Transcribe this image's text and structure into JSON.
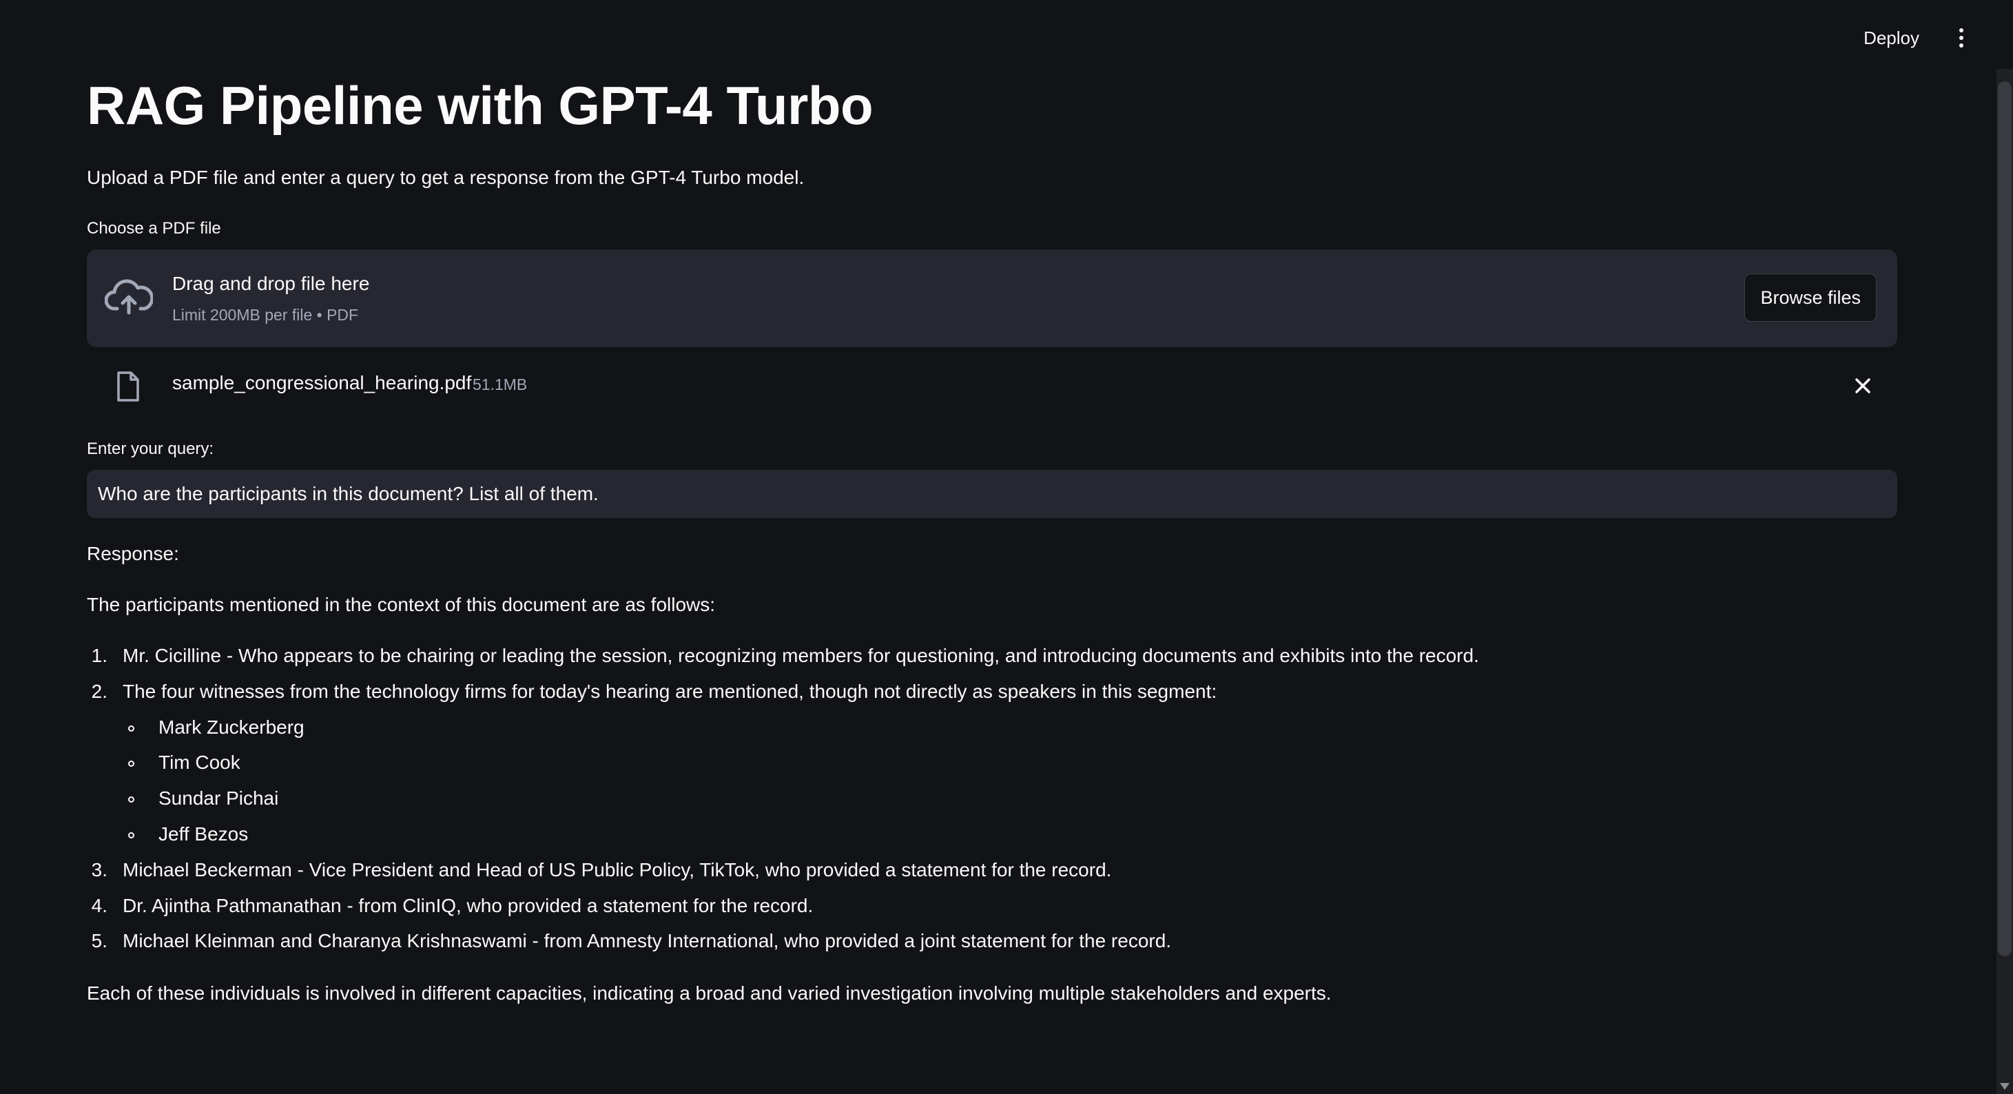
{
  "header": {
    "deploy_label": "Deploy",
    "menu_icon": "kebab-menu-icon"
  },
  "main": {
    "title": "RAG Pipeline with GPT-4 Turbo",
    "subtitle": "Upload a PDF file and enter a query to get a response from the GPT-4 Turbo model."
  },
  "uploader": {
    "label": "Choose a PDF file",
    "drop_text": "Drag and drop file here",
    "limit_text": "Limit 200MB per file • PDF",
    "browse_label": "Browse files",
    "icon": "upload-cloud-icon",
    "file": {
      "name": "sample_congressional_hearing.pdf",
      "size": "51.1MB",
      "icon": "file-icon",
      "remove_icon": "close-icon"
    }
  },
  "query": {
    "label": "Enter your query:",
    "value": "Who are the participants in this document? List all of them."
  },
  "response": {
    "label": "Response:",
    "intro": "The participants mentioned in the context of this document are as follows:",
    "items": [
      {
        "num": "1.",
        "text": "Mr. Cicilline - Who appears to be chairing or leading the session, recognizing members for questioning, and introducing documents and exhibits into the record."
      },
      {
        "num": "2.",
        "text": "The four witnesses from the technology firms for today's hearing are mentioned, though not directly as speakers in this segment:"
      },
      {
        "num": "3.",
        "text": "Michael Beckerman - Vice President and Head of US Public Policy, TikTok, who provided a statement for the record."
      },
      {
        "num": "4.",
        "text": "Dr. Ajintha Pathmanathan - from ClinIQ, who provided a statement for the record."
      },
      {
        "num": "5.",
        "text": "Michael Kleinman and Charanya Krishnaswami - from Amnesty International, who provided a joint statement for the record."
      }
    ],
    "sub_items": [
      "Mark Zuckerberg",
      "Tim Cook",
      "Sundar Pichai",
      "Jeff Bezos"
    ],
    "conclusion": "Each of these individuals is involved in different capacities, indicating a broad and varied investigation involving multiple stakeholders and experts."
  }
}
